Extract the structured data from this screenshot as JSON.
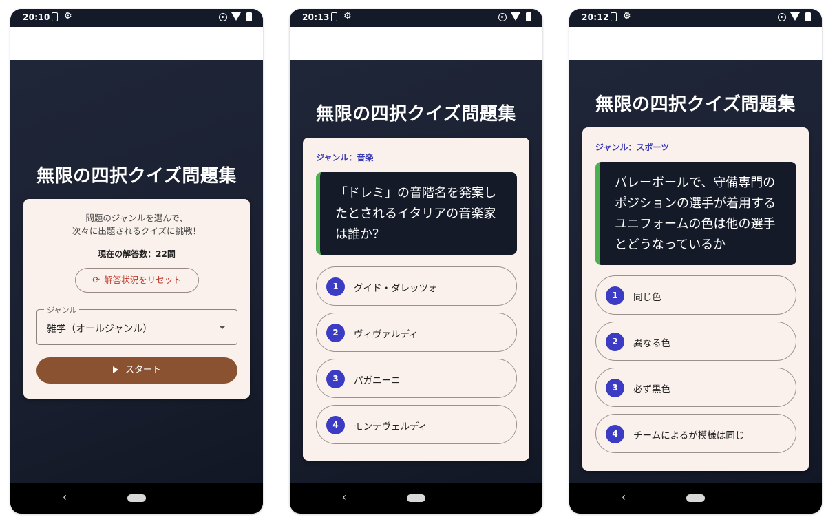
{
  "app": {
    "title": "無限の四択クイズ問題集",
    "accent_color": "#3b3bc4",
    "brand_button_color": "#8a5230"
  },
  "screens": [
    {
      "status_time": "20:10",
      "home": {
        "intro_line1": "問題のジャンルを選んで、",
        "intro_line2": "次々に出題されるクイズに挑戦！",
        "answer_count": "現在の解答数：22問",
        "reset_label": "解答状況をリセット",
        "reset_icon": "refresh-icon",
        "genre_legend": "ジャンル",
        "genre_value": "雑学（オールジャンル）",
        "start_label": "スタート"
      }
    },
    {
      "status_time": "20:13",
      "genre": "ジャンル：音楽",
      "question": "「ドレミ」の音階名を発案したとされるイタリアの音楽家は誰か？",
      "options": [
        {
          "num": "1",
          "label": "グイド・ダレッツォ"
        },
        {
          "num": "2",
          "label": "ヴィヴァルディ"
        },
        {
          "num": "3",
          "label": "パガニーニ"
        },
        {
          "num": "4",
          "label": "モンテヴェルディ"
        }
      ]
    },
    {
      "status_time": "20:12",
      "genre": "ジャンル：スポーツ",
      "question": "バレーボールで、守備専門のポジションの選手が着用するユニフォームの色は他の選手とどうなっているか",
      "options": [
        {
          "num": "1",
          "label": "同じ色"
        },
        {
          "num": "2",
          "label": "異なる色"
        },
        {
          "num": "3",
          "label": "必ず黒色"
        },
        {
          "num": "4",
          "label": "チームによるが模様は同じ"
        }
      ]
    }
  ]
}
